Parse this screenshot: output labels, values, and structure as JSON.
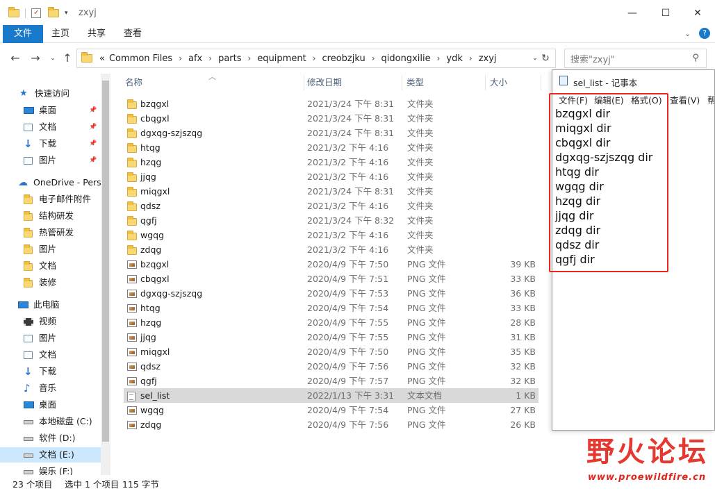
{
  "titlebar": {
    "title": "zxyj",
    "minimize": "—",
    "maximize": "☐",
    "close": "✕"
  },
  "ribbon": {
    "tabs": [
      "文件",
      "主页",
      "共享",
      "查看"
    ]
  },
  "address": {
    "overflow": "«",
    "crumbs": [
      "Common Files",
      "afx",
      "parts",
      "equipment",
      "creobzjku",
      "qidongxilie",
      "ydk",
      "zxyj"
    ],
    "search_placeholder": "搜索\"zxyj\""
  },
  "nav": {
    "items": [
      {
        "label": "快速访问",
        "icon": "star-icon"
      },
      {
        "label": "桌面",
        "icon": "desktop-icon",
        "pinned": true
      },
      {
        "label": "文档",
        "icon": "document-icon",
        "pinned": true
      },
      {
        "label": "下载",
        "icon": "download-icon",
        "pinned": true
      },
      {
        "label": "图片",
        "icon": "picture-icon",
        "pinned": true
      },
      {
        "label": "OneDrive - Perso",
        "icon": "cloud-icon"
      },
      {
        "label": "电子邮件附件",
        "icon": "folder-icon"
      },
      {
        "label": "结构研发",
        "icon": "folder-icon"
      },
      {
        "label": "热管研发",
        "icon": "folder-icon"
      },
      {
        "label": "图片",
        "icon": "folder-icon"
      },
      {
        "label": "文档",
        "icon": "folder-icon"
      },
      {
        "label": "装修",
        "icon": "folder-icon"
      },
      {
        "label": "此电脑",
        "icon": "computer-icon"
      },
      {
        "label": "视频",
        "icon": "video-icon"
      },
      {
        "label": "图片",
        "icon": "picture-icon"
      },
      {
        "label": "文档",
        "icon": "document-icon"
      },
      {
        "label": "下载",
        "icon": "download-icon"
      },
      {
        "label": "音乐",
        "icon": "music-icon"
      },
      {
        "label": "桌面",
        "icon": "desktop-icon"
      },
      {
        "label": "本地磁盘 (C:)",
        "icon": "drive-icon"
      },
      {
        "label": "软件 (D:)",
        "icon": "drive-icon"
      },
      {
        "label": "文档 (E:)",
        "icon": "drive-icon",
        "selected": true
      },
      {
        "label": "娱乐 (F:)",
        "icon": "drive-icon"
      }
    ]
  },
  "columns": {
    "name": "名称",
    "date": "修改日期",
    "type": "类型",
    "size": "大小"
  },
  "files": [
    {
      "name": "bzqgxl",
      "date": "2021/3/24 下午 8:31",
      "type": "文件夹",
      "size": "",
      "kind": "folder"
    },
    {
      "name": "cbqgxl",
      "date": "2021/3/24 下午 8:31",
      "type": "文件夹",
      "size": "",
      "kind": "folder"
    },
    {
      "name": "dgxqg-szjszqg",
      "date": "2021/3/24 下午 8:31",
      "type": "文件夹",
      "size": "",
      "kind": "folder"
    },
    {
      "name": "htqg",
      "date": "2021/3/2 下午 4:16",
      "type": "文件夹",
      "size": "",
      "kind": "folder"
    },
    {
      "name": "hzqg",
      "date": "2021/3/2 下午 4:16",
      "type": "文件夹",
      "size": "",
      "kind": "folder"
    },
    {
      "name": "jjqg",
      "date": "2021/3/2 下午 4:16",
      "type": "文件夹",
      "size": "",
      "kind": "folder"
    },
    {
      "name": "miqgxl",
      "date": "2021/3/24 下午 8:31",
      "type": "文件夹",
      "size": "",
      "kind": "folder"
    },
    {
      "name": "qdsz",
      "date": "2021/3/2 下午 4:16",
      "type": "文件夹",
      "size": "",
      "kind": "folder"
    },
    {
      "name": "qgfj",
      "date": "2021/3/24 下午 8:32",
      "type": "文件夹",
      "size": "",
      "kind": "folder"
    },
    {
      "name": "wgqg",
      "date": "2021/3/2 下午 4:16",
      "type": "文件夹",
      "size": "",
      "kind": "folder"
    },
    {
      "name": "zdqg",
      "date": "2021/3/2 下午 4:16",
      "type": "文件夹",
      "size": "",
      "kind": "folder"
    },
    {
      "name": "bzqgxl",
      "date": "2020/4/9 下午 7:50",
      "type": "PNG 文件",
      "size": "39 KB",
      "kind": "png"
    },
    {
      "name": "cbqgxl",
      "date": "2020/4/9 下午 7:51",
      "type": "PNG 文件",
      "size": "33 KB",
      "kind": "png"
    },
    {
      "name": "dgxqg-szjszqg",
      "date": "2020/4/9 下午 7:53",
      "type": "PNG 文件",
      "size": "36 KB",
      "kind": "png"
    },
    {
      "name": "htqg",
      "date": "2020/4/9 下午 7:54",
      "type": "PNG 文件",
      "size": "33 KB",
      "kind": "png"
    },
    {
      "name": "hzqg",
      "date": "2020/4/9 下午 7:55",
      "type": "PNG 文件",
      "size": "28 KB",
      "kind": "png"
    },
    {
      "name": "jjqg",
      "date": "2020/4/9 下午 7:55",
      "type": "PNG 文件",
      "size": "31 KB",
      "kind": "png"
    },
    {
      "name": "miqgxl",
      "date": "2020/4/9 下午 7:50",
      "type": "PNG 文件",
      "size": "35 KB",
      "kind": "png"
    },
    {
      "name": "qdsz",
      "date": "2020/4/9 下午 7:56",
      "type": "PNG 文件",
      "size": "32 KB",
      "kind": "png"
    },
    {
      "name": "qgfj",
      "date": "2020/4/9 下午 7:57",
      "type": "PNG 文件",
      "size": "32 KB",
      "kind": "png"
    },
    {
      "name": "sel_list",
      "date": "2022/1/13 下午 3:31",
      "type": "文本文档",
      "size": "1 KB",
      "kind": "txt",
      "selected": true
    },
    {
      "name": "wgqg",
      "date": "2020/4/9 下午 7:54",
      "type": "PNG 文件",
      "size": "27 KB",
      "kind": "png"
    },
    {
      "name": "zdqg",
      "date": "2020/4/9 下午 7:56",
      "type": "PNG 文件",
      "size": "26 KB",
      "kind": "png"
    }
  ],
  "status": {
    "count": "23 个项目",
    "selection": "选中 1 个项目",
    "size": "115 字节"
  },
  "notepad": {
    "title": "sel_list - 记事本",
    "menu": [
      "文件(F)",
      "编辑(E)",
      "格式(O)",
      "查看(V)",
      "帮"
    ],
    "lines": [
      "bzqgxl dir",
      "miqgxl dir",
      "cbqgxl dir",
      "dgxqg-szjszqg dir",
      "htqg dir",
      "wgqg dir",
      "hzqg dir",
      "jjqg dir",
      "zdqg dir",
      "qdsz dir",
      "qgfj dir"
    ]
  },
  "watermark": {
    "text": "野火论坛",
    "url": "www.proewildfire.cn"
  },
  "colors": {
    "accent": "#1979ca",
    "highlight": "#e8281f",
    "selected_row": "#d9d9d9",
    "folder": "#f8d775"
  }
}
